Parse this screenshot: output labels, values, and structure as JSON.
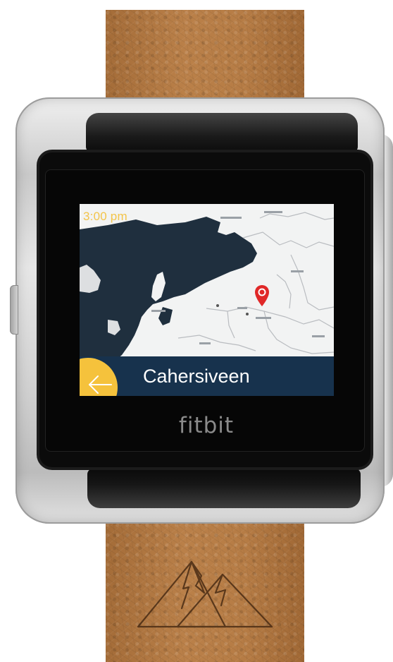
{
  "status": {
    "time": "3:00 pm"
  },
  "location": {
    "name": "Cahersiveen"
  },
  "device": {
    "brand": "fitbit"
  },
  "icons": {
    "back": "back-arrow-icon",
    "pin": "map-pin-icon",
    "strap_logo": "mountain-logo"
  },
  "colors": {
    "time_text": "#f3c44a",
    "location_bar": "#17324d",
    "back_button": "#f5c23c",
    "pin": "#e02828",
    "land": "#f2f3f3",
    "water": "#1f2f3e",
    "strap": "#b27a44"
  }
}
